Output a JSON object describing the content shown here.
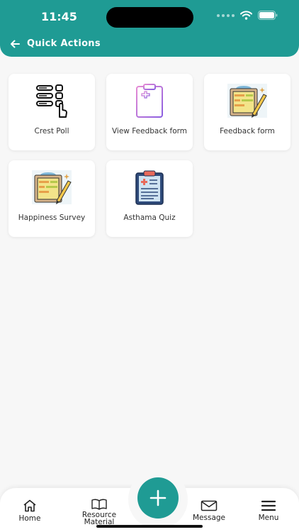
{
  "status_bar": {
    "time": "11:45"
  },
  "header": {
    "title": "Quick Actions"
  },
  "actions": [
    {
      "label": "Crest Poll",
      "icon": "poll-icon"
    },
    {
      "label": "View Feedback form",
      "icon": "clipboard-icon"
    },
    {
      "label": "Feedback form",
      "icon": "clipboard-pencil-icon"
    },
    {
      "label": "Happiness Survey",
      "icon": "clipboard-pencil-icon"
    },
    {
      "label": "Asthama Quiz",
      "icon": "medical-clipboard-icon"
    }
  ],
  "bottom_nav": {
    "home": "Home",
    "resource_line1": "Resource",
    "resource_line2": "Material",
    "message": "Message",
    "menu": "Menu"
  },
  "colors": {
    "accent": "#1f9b94"
  }
}
